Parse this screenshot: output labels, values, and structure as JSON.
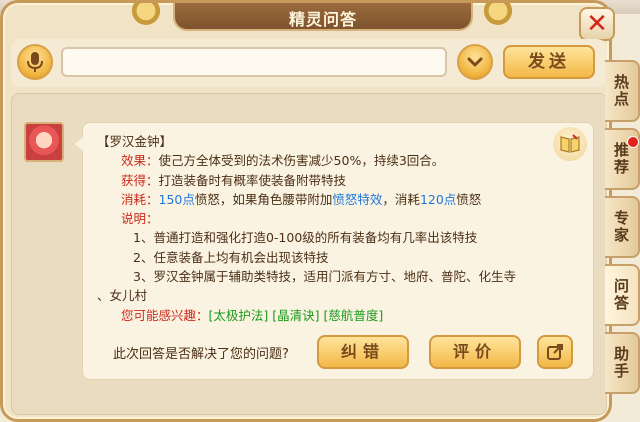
{
  "window": {
    "title": "精灵问答",
    "close_icon": "close-icon"
  },
  "input_bar": {
    "voice_icon": "microphone-icon",
    "search_value": "",
    "search_placeholder": "",
    "dropdown_icon": "chevron-down-icon",
    "send_label": "发送"
  },
  "answer": {
    "avatar_icon": "sprite-avatar",
    "book_icon": "book-icon",
    "heading": "【罗汉金钟】",
    "effect_label": "效果",
    "effect_text": "使己方全体受到的法术伤害减少50%，持续3回合。",
    "obtain_label": "获得",
    "obtain_text": "打造装备时有概率使装备附带特技",
    "cost_label": "消耗",
    "cost_value1": "150点",
    "cost_text1": "愤怒，如果角色腰带附加",
    "cost_link": "愤怒特效",
    "cost_text2": "，消耗",
    "cost_value2": "120点",
    "cost_text3": "愤怒",
    "desc_label": "说明",
    "desc_items": [
      "1、普通打造和强化打造0-100级的所有装备均有几率出该特技",
      "2、任意装备上均有机会出现该特技",
      "3、罗汉金钟属于辅助类特技，适用门派有方寸、地府、普陀、化生寺"
    ],
    "desc_item3_cont": "、女儿村",
    "interest_label": "您可能感兴趣",
    "interest_links": [
      "[太极护法]",
      "[晶清诀]",
      "[慈航普度]"
    ]
  },
  "feedback": {
    "question": "此次回答是否解决了您的问题?",
    "correct_label": "纠错",
    "rate_label": "评价",
    "share_icon": "share-icon"
  },
  "side_tabs": [
    {
      "label": "热点",
      "active": false,
      "badge": false
    },
    {
      "label": "推荐",
      "active": false,
      "badge": true
    },
    {
      "label": "专家",
      "active": false,
      "badge": false
    },
    {
      "label": "问答",
      "active": true,
      "badge": false
    },
    {
      "label": "助手",
      "active": false,
      "badge": false
    }
  ],
  "colors": {
    "accent_red": "#cc2a1a",
    "link_blue": "#1f78d8",
    "link_green": "#1a9a1a",
    "button_gold": "#f2b847"
  }
}
